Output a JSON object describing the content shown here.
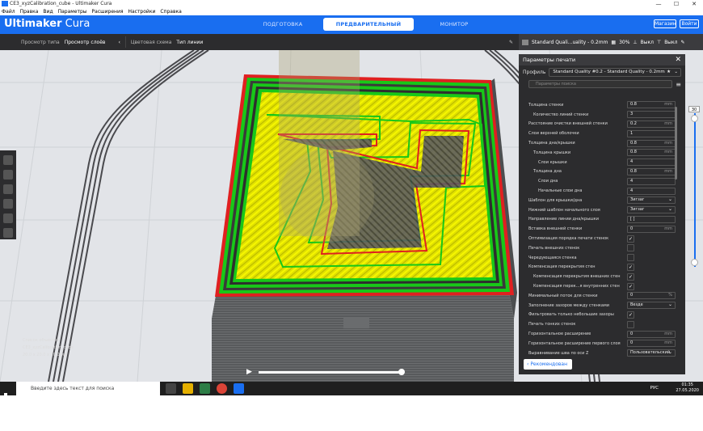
{
  "titlebar": {
    "title": "CE3_xyzCalibration_cube - Ultimaker Cura",
    "controls": [
      "—",
      "☐",
      "✕"
    ]
  },
  "menu": [
    "Файл",
    "Правка",
    "Вид",
    "Параметры",
    "Расширения",
    "Настройки",
    "Справка"
  ],
  "header": {
    "logo_bold": "Ultimaker",
    "logo_light": " Cura",
    "stages": [
      "ПОДГОТОВКА",
      "ПРЕДВАРИТЕЛЬНЫЙ ПРОСМОТР",
      "МОНИТОР"
    ],
    "active_stage": 1,
    "marketplace": "Магазин",
    "signin": "Войти",
    "accent": "#196ef0"
  },
  "toolbar": {
    "view_type_label": "Просмотр типа",
    "view_type_value": "Просмотр слоёв",
    "color_scheme_label": "Цветовая схема",
    "color_scheme_value": "Тип линии",
    "profile_summary": "Standard Quali...uality - 0.2mm",
    "infill": "30%",
    "support": "Выкл",
    "adhesion": "Выкл"
  },
  "panel": {
    "title": "Параметры печати",
    "profile_label": "Профиль",
    "profile_value": "Standard Quality #0.2 - Standard Quality - 0.2mm",
    "search_placeholder": "Параметры поиска",
    "recommended": "Рекомендован"
  },
  "settings": [
    {
      "label": "Толщина стенки",
      "indent": 0,
      "type": "value",
      "value": "0.8",
      "unit": "mm"
    },
    {
      "label": "Количество линий стенки",
      "indent": 1,
      "type": "value",
      "value": "3",
      "unit": ""
    },
    {
      "label": "Расстояние очистки внешней стенки",
      "indent": 0,
      "type": "value",
      "value": "0.2",
      "unit": "mm"
    },
    {
      "label": "Слои верхней оболочки",
      "indent": 0,
      "type": "value",
      "value": "1",
      "unit": ""
    },
    {
      "label": "Толщина дна/крышки",
      "indent": 0,
      "type": "value",
      "value": "0.8",
      "unit": "mm"
    },
    {
      "label": "Толщина крышки",
      "indent": 1,
      "type": "value",
      "value": "0.8",
      "unit": "mm"
    },
    {
      "label": "Слои крышки",
      "indent": 2,
      "type": "value",
      "value": "4",
      "unit": ""
    },
    {
      "label": "Толщина дна",
      "indent": 1,
      "type": "value",
      "value": "0.8",
      "unit": "mm"
    },
    {
      "label": "Слои дна",
      "indent": 2,
      "type": "value",
      "value": "4",
      "unit": ""
    },
    {
      "label": "Начальные слои дна",
      "indent": 2,
      "type": "value",
      "value": "4",
      "unit": ""
    },
    {
      "label": "Шаблон для крышки/дна",
      "indent": 0,
      "type": "dropdown",
      "value": "Зигзаг"
    },
    {
      "label": "Нижний шаблон начального слоя",
      "indent": 0,
      "type": "dropdown",
      "value": "Зигзаг"
    },
    {
      "label": "Направление линии дна/крышки",
      "indent": 0,
      "type": "value",
      "value": "[ ]",
      "unit": ""
    },
    {
      "label": "Вставка внешней стенки",
      "indent": 0,
      "type": "value",
      "value": "0",
      "unit": "mm"
    },
    {
      "label": "Оптимизация порядка печати стенок",
      "indent": 0,
      "type": "check",
      "value": "✓"
    },
    {
      "label": "Печать внешних стенок",
      "indent": 0,
      "type": "check",
      "value": ""
    },
    {
      "label": "Чередующаяся стенка",
      "indent": 0,
      "type": "check",
      "value": ""
    },
    {
      "label": "Компенсация перекрытия стен",
      "indent": 0,
      "type": "check",
      "value": "✓"
    },
    {
      "label": "Компенсация перекрытия внешних стен",
      "indent": 1,
      "type": "check",
      "value": "✓"
    },
    {
      "label": "Компенсация перек...я внутренних стен",
      "indent": 1,
      "type": "check",
      "value": "✓"
    },
    {
      "label": "Минимальный поток для стенки",
      "indent": 0,
      "type": "value",
      "value": "0",
      "unit": "%"
    },
    {
      "label": "Заполнение зазоров между стенками",
      "indent": 0,
      "type": "dropdown",
      "value": "Везде"
    },
    {
      "label": "Фильтровать только небольшие зазоры",
      "indent": 0,
      "type": "check",
      "value": "✓"
    },
    {
      "label": "Печать тонких стенок",
      "indent": 0,
      "type": "check",
      "value": ""
    },
    {
      "label": "Горизонтальное расширение",
      "indent": 0,
      "type": "value",
      "value": "0",
      "unit": "mm"
    },
    {
      "label": "Горизонтальное расширение первого слоя",
      "indent": 0,
      "type": "value",
      "value": "0",
      "unit": "mm"
    },
    {
      "label": "Выравнивание шва по оси Z",
      "indent": 0,
      "type": "dropdown",
      "value": "Пользовательский"
    }
  ],
  "layer_view": {
    "current_layer": "30",
    "progress": 1.0
  },
  "objects": {
    "header": "Список объектов",
    "item": "CE3_xyzCalibration_cube",
    "dims": "20.0 x 20.0 x 20.0 мм"
  },
  "taskbar": {
    "search": "Введите здесь текст для поиска",
    "lang": "РУС",
    "time": "01:35",
    "date": "27.05.2020"
  }
}
